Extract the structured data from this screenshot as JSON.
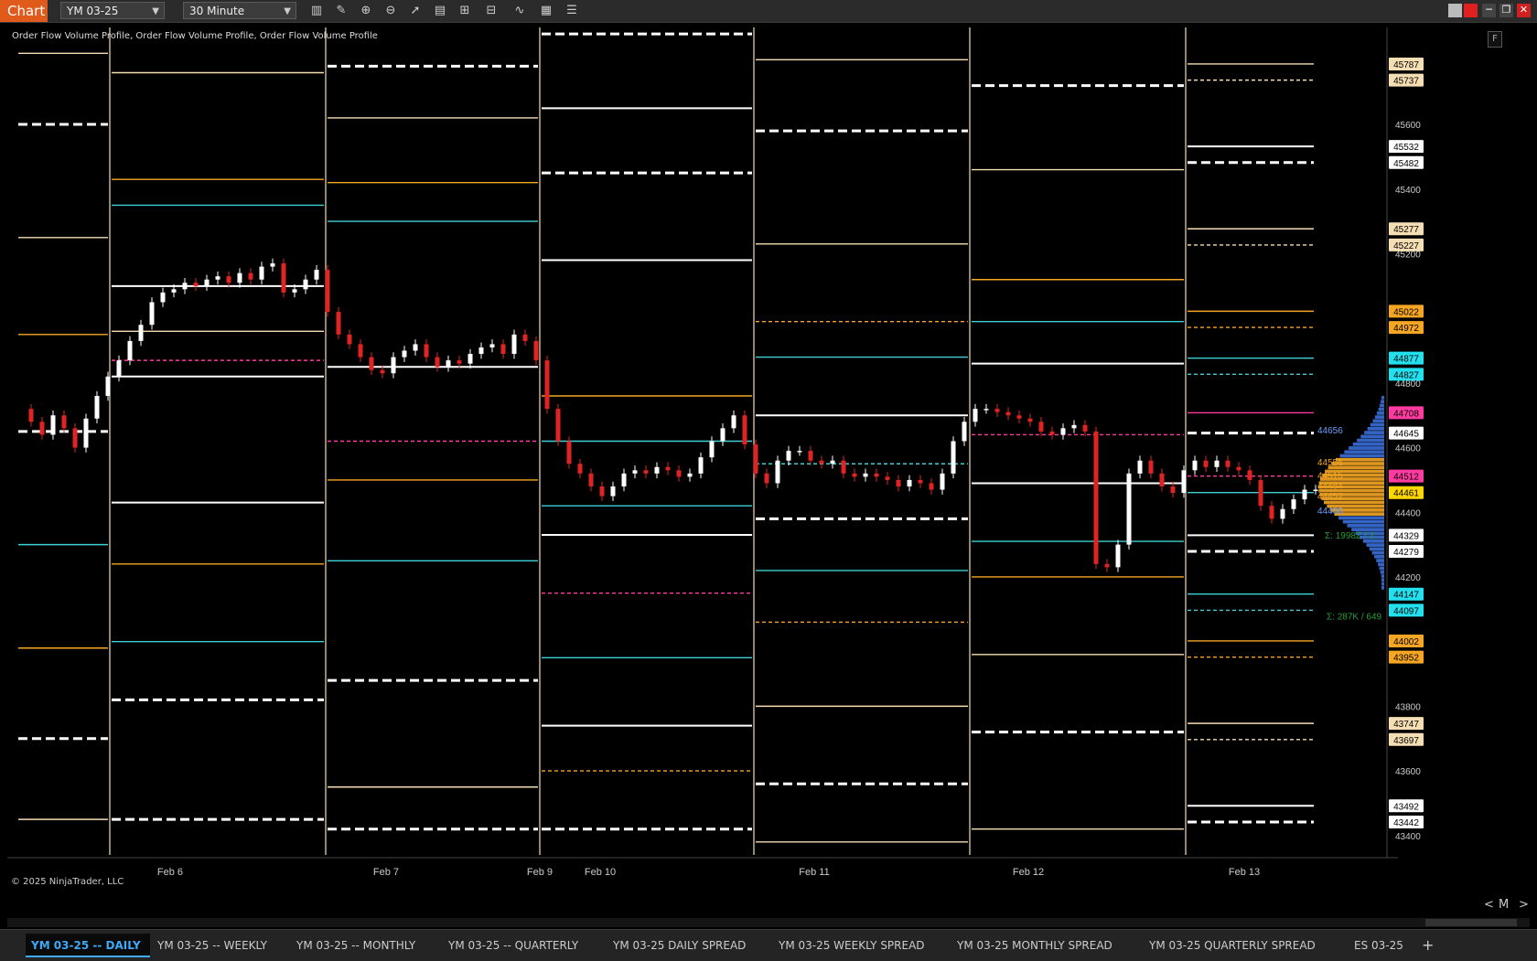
{
  "toolbar": {
    "app_tab": "Chart",
    "instrument": "YM 03-25",
    "timeframe": "30 Minute",
    "tool_icons": [
      "bars-icon",
      "pencil-icon",
      "zoom-in-icon",
      "zoom-out-icon",
      "cursor-icon",
      "properties-icon",
      "template-icon",
      "strategy-icon",
      "indicator-icon",
      "calculator-icon",
      "list-icon"
    ]
  },
  "chart": {
    "indicator_label": "Order Flow Volume Profile, Order Flow Volume Profile, Order Flow Volume Profile",
    "copyright": "© 2025 NinjaTrader, LLC",
    "f_button": "F",
    "zoom": {
      "left": "<",
      "mode": "M",
      "right": ">"
    }
  },
  "chart_data": {
    "type": "candlestick",
    "x_labels": [
      "Feb 6",
      "Feb 7",
      "Feb 9",
      "Feb 10",
      "Feb 11",
      "Feb 12",
      "Feb 13"
    ],
    "y_ticks": [
      45600,
      45400,
      45200,
      44800,
      44600,
      44400,
      44200,
      43800,
      43600,
      43400
    ],
    "ylim": [
      43340,
      45900
    ],
    "colors": {
      "white": "#ffffff",
      "cream": "#f5deb3",
      "orange": "#f5a623",
      "cyan": "#3fd0d4",
      "pink": "#ff3aa0",
      "up": "#ffffff",
      "down": "#e02424"
    },
    "price_badges": [
      {
        "value": "45787",
        "color": "#f5deb3"
      },
      {
        "value": "45737",
        "color": "#f5deb3"
      },
      {
        "value": "45532",
        "color": "#ffffff"
      },
      {
        "value": "45482",
        "color": "#ffffff"
      },
      {
        "value": "45277",
        "color": "#f5deb3"
      },
      {
        "value": "45227",
        "color": "#f5deb3"
      },
      {
        "value": "45022",
        "color": "#f5a623"
      },
      {
        "value": "44972",
        "color": "#f5a623"
      },
      {
        "value": "44877",
        "color": "#22e0ee"
      },
      {
        "value": "44827",
        "color": "#22e0ee"
      },
      {
        "value": "44708",
        "color": "#ff3aa0"
      },
      {
        "value": "44645",
        "color": "#ffffff"
      },
      {
        "value": "44512",
        "color": "#ff3aa0"
      },
      {
        "value": "44461",
        "color": "#ffd700"
      },
      {
        "value": "44329",
        "color": "#ffffff"
      },
      {
        "value": "44279",
        "color": "#ffffff"
      },
      {
        "value": "44147",
        "color": "#22e0ee"
      },
      {
        "value": "44097",
        "color": "#22e0ee"
      },
      {
        "value": "44002",
        "color": "#f5a623"
      },
      {
        "value": "43952",
        "color": "#f5a623"
      },
      {
        "value": "43747",
        "color": "#f5deb3"
      },
      {
        "value": "43697",
        "color": "#f5deb3"
      },
      {
        "value": "43492",
        "color": "#ffffff"
      },
      {
        "value": "43442",
        "color": "#ffffff"
      }
    ],
    "profile_labels": [
      "44656",
      "44556",
      "44515",
      "44484",
      "44452",
      "44406"
    ],
    "volume_labels": [
      "Σ: 1998Z / 2…",
      "Σ: 287K / 649"
    ],
    "sessions": [
      {
        "levels": [
          {
            "v": 45820,
            "c": "cream",
            "s": 0
          },
          {
            "v": 45600,
            "c": "white",
            "s": 1
          },
          {
            "v": 45250,
            "c": "cream",
            "s": 0
          },
          {
            "v": 44950,
            "c": "orange",
            "s": 0
          },
          {
            "v": 44650,
            "c": "white",
            "s": 1
          },
          {
            "v": 44300,
            "c": "cyan",
            "s": 0
          },
          {
            "v": 43980,
            "c": "orange",
            "s": 0
          },
          {
            "v": 43700,
            "c": "white",
            "s": 1
          },
          {
            "v": 43450,
            "c": "cream",
            "s": 0
          }
        ]
      },
      {
        "levels": [
          {
            "v": 45760,
            "c": "cream",
            "s": 0
          },
          {
            "v": 45430,
            "c": "orange",
            "s": 0
          },
          {
            "v": 45350,
            "c": "cyan",
            "s": 0
          },
          {
            "v": 45100,
            "c": "white",
            "s": 0
          },
          {
            "v": 44960,
            "c": "cream",
            "s": 0
          },
          {
            "v": 44820,
            "c": "white",
            "s": 0
          },
          {
            "v": 44870,
            "c": "pink",
            "s": 1
          },
          {
            "v": 44430,
            "c": "white",
            "s": 0
          },
          {
            "v": 44240,
            "c": "orange",
            "s": 0
          },
          {
            "v": 44000,
            "c": "cyan",
            "s": 0
          },
          {
            "v": 43820,
            "c": "white",
            "s": 1
          },
          {
            "v": 43450,
            "c": "white",
            "s": 1
          }
        ]
      },
      {
        "levels": [
          {
            "v": 45780,
            "c": "white",
            "s": 1
          },
          {
            "v": 45620,
            "c": "cream",
            "s": 0
          },
          {
            "v": 45420,
            "c": "orange",
            "s": 0
          },
          {
            "v": 45300,
            "c": "cyan",
            "s": 0
          },
          {
            "v": 44850,
            "c": "white",
            "s": 0
          },
          {
            "v": 44620,
            "c": "pink",
            "s": 1
          },
          {
            "v": 44500,
            "c": "orange",
            "s": 0
          },
          {
            "v": 44250,
            "c": "cyan",
            "s": 0
          },
          {
            "v": 43880,
            "c": "white",
            "s": 1
          },
          {
            "v": 43550,
            "c": "cream",
            "s": 0
          },
          {
            "v": 43420,
            "c": "white",
            "s": 1
          }
        ]
      },
      {
        "levels": [
          {
            "v": 45880,
            "c": "white",
            "s": 1
          },
          {
            "v": 45650,
            "c": "white",
            "s": 0
          },
          {
            "v": 45450,
            "c": "white",
            "s": 1
          },
          {
            "v": 45180,
            "c": "white",
            "s": 0
          },
          {
            "v": 44760,
            "c": "orange",
            "s": 0
          },
          {
            "v": 44620,
            "c": "cyan",
            "s": 0
          },
          {
            "v": 44420,
            "c": "cyan",
            "s": 0
          },
          {
            "v": 44330,
            "c": "white",
            "s": 0
          },
          {
            "v": 44150,
            "c": "pink",
            "s": 1
          },
          {
            "v": 43950,
            "c": "cyan",
            "s": 0
          },
          {
            "v": 43740,
            "c": "white",
            "s": 0
          },
          {
            "v": 43600,
            "c": "orange",
            "s": 1
          },
          {
            "v": 43420,
            "c": "white",
            "s": 1
          }
        ]
      },
      {
        "levels": [
          {
            "v": 45800,
            "c": "cream",
            "s": 0
          },
          {
            "v": 45580,
            "c": "white",
            "s": 1
          },
          {
            "v": 45230,
            "c": "cream",
            "s": 0
          },
          {
            "v": 44990,
            "c": "orange",
            "s": 1
          },
          {
            "v": 44880,
            "c": "cyan",
            "s": 0
          },
          {
            "v": 44700,
            "c": "white",
            "s": 0
          },
          {
            "v": 44550,
            "c": "cyan",
            "s": 1
          },
          {
            "v": 44380,
            "c": "white",
            "s": 1
          },
          {
            "v": 44220,
            "c": "cyan",
            "s": 0
          },
          {
            "v": 44060,
            "c": "orange",
            "s": 1
          },
          {
            "v": 43800,
            "c": "cream",
            "s": 0
          },
          {
            "v": 43560,
            "c": "white",
            "s": 1
          },
          {
            "v": 43380,
            "c": "cream",
            "s": 0
          }
        ]
      },
      {
        "levels": [
          {
            "v": 45720,
            "c": "white",
            "s": 1
          },
          {
            "v": 45460,
            "c": "cream",
            "s": 0
          },
          {
            "v": 45120,
            "c": "orange",
            "s": 0
          },
          {
            "v": 44990,
            "c": "cyan",
            "s": 0
          },
          {
            "v": 44860,
            "c": "white",
            "s": 0
          },
          {
            "v": 44640,
            "c": "pink",
            "s": 1
          },
          {
            "v": 44490,
            "c": "white",
            "s": 0
          },
          {
            "v": 44310,
            "c": "cyan",
            "s": 0
          },
          {
            "v": 44200,
            "c": "orange",
            "s": 0
          },
          {
            "v": 43960,
            "c": "cream",
            "s": 0
          },
          {
            "v": 43720,
            "c": "white",
            "s": 1
          },
          {
            "v": 43420,
            "c": "cream",
            "s": 0
          }
        ]
      },
      {
        "levels": [
          {
            "v": 45787,
            "c": "cream",
            "s": 0
          },
          {
            "v": 45737,
            "c": "cream",
            "s": 1
          },
          {
            "v": 45532,
            "c": "white",
            "s": 0
          },
          {
            "v": 45482,
            "c": "white",
            "s": 1
          },
          {
            "v": 45277,
            "c": "cream",
            "s": 0
          },
          {
            "v": 45227,
            "c": "cream",
            "s": 1
          },
          {
            "v": 45022,
            "c": "orange",
            "s": 0
          },
          {
            "v": 44972,
            "c": "orange",
            "s": 1
          },
          {
            "v": 44877,
            "c": "cyan",
            "s": 0
          },
          {
            "v": 44827,
            "c": "cyan",
            "s": 1
          },
          {
            "v": 44708,
            "c": "pink",
            "s": 0
          },
          {
            "v": 44645,
            "c": "white",
            "s": 1
          },
          {
            "v": 44512,
            "c": "pink",
            "s": 1
          },
          {
            "v": 44461,
            "c": "cyan",
            "s": 0
          },
          {
            "v": 44329,
            "c": "white",
            "s": 0
          },
          {
            "v": 44279,
            "c": "white",
            "s": 1
          },
          {
            "v": 44147,
            "c": "cyan",
            "s": 0
          },
          {
            "v": 44097,
            "c": "cyan",
            "s": 1
          },
          {
            "v": 44002,
            "c": "orange",
            "s": 0
          },
          {
            "v": 43952,
            "c": "orange",
            "s": 1
          },
          {
            "v": 43747,
            "c": "cream",
            "s": 0
          },
          {
            "v": 43697,
            "c": "cream",
            "s": 1
          },
          {
            "v": 43492,
            "c": "white",
            "s": 0
          },
          {
            "v": 43442,
            "c": "white",
            "s": 1
          }
        ]
      }
    ],
    "price_path": [
      44720,
      44680,
      44640,
      44700,
      44660,
      44600,
      44690,
      44760,
      44820,
      44870,
      44930,
      44980,
      45050,
      45080,
      45090,
      45110,
      45100,
      45120,
      45130,
      45110,
      45140,
      45120,
      45160,
      45170,
      45080,
      45090,
      45120,
      45150,
      45020,
      44950,
      44920,
      44880,
      44840,
      44830,
      44880,
      44900,
      44920,
      44880,
      44850,
      44870,
      44860,
      44890,
      44910,
      44920,
      44890,
      44950,
      44930,
      44870,
      44720,
      44620,
      44550,
      44520,
      44480,
      44450,
      44480,
      44520,
      44530,
      44520,
      44540,
      44530,
      44510,
      44520,
      44570,
      44620,
      44660,
      44700,
      44610,
      44520,
      44490,
      44560,
      44590,
      44590,
      44560,
      44550,
      44560,
      44520,
      44510,
      44520,
      44510,
      44500,
      44480,
      44500,
      44490,
      44470,
      44520,
      44620,
      44680,
      44720,
      44720,
      44710,
      44700,
      44690,
      44680,
      44650,
      44640,
      44660,
      44670,
      44650,
      44240,
      44230,
      44300,
      44520,
      44560,
      44520,
      44480,
      44460,
      44530,
      44560,
      44540,
      44560,
      44540,
      44530,
      44500,
      44420,
      44380,
      44410,
      44440,
      44470,
      44470
    ]
  },
  "tabs": [
    {
      "label": "YM 03-25 -- DAILY",
      "active": true
    },
    {
      "label": "YM 03-25 -- WEEKLY",
      "active": false
    },
    {
      "label": "YM 03-25 -- MONTHLY",
      "active": false
    },
    {
      "label": "YM 03-25 -- QUARTERLY",
      "active": false
    },
    {
      "label": "YM 03-25 DAILY SPREAD",
      "active": false
    },
    {
      "label": "YM 03-25 WEEKLY SPREAD",
      "active": false
    },
    {
      "label": "YM 03-25 MONTHLY SPREAD",
      "active": false
    },
    {
      "label": "YM 03-25 QUARTERLY SPREAD",
      "active": false
    },
    {
      "label": "ES 03-25",
      "active": false
    }
  ],
  "add_tab": "+"
}
